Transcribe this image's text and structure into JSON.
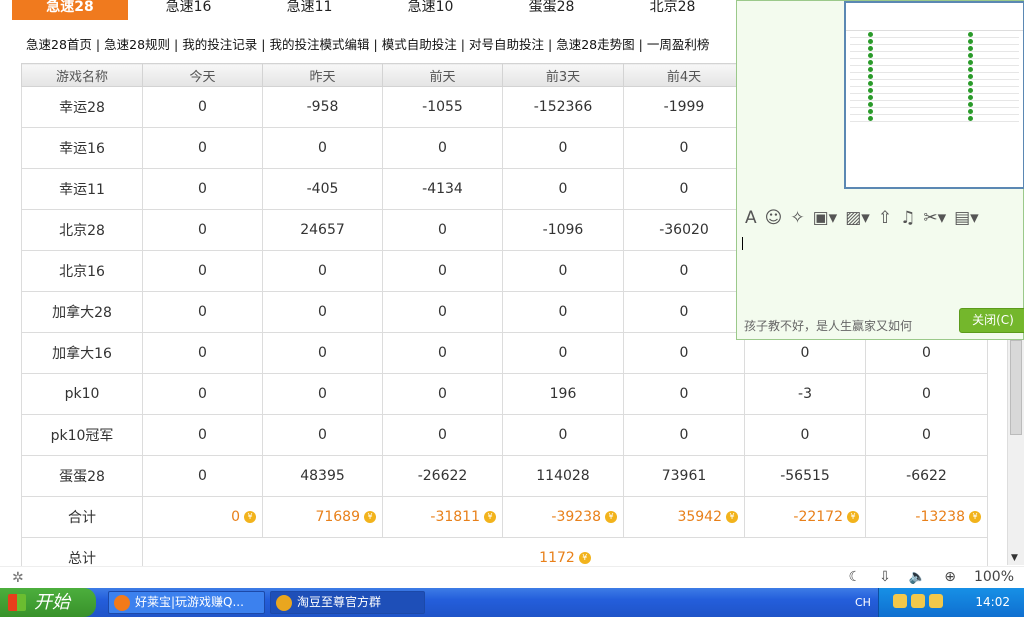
{
  "tabs": [
    "急速28",
    "急速16",
    "急速11",
    "急速10",
    "蛋蛋28",
    "北京28"
  ],
  "subnav": [
    "急速28首页",
    "急速28规则",
    "我的投注记录",
    "我的投注模式编辑",
    "模式自助投注",
    "对号自助投注",
    "急速28走势图",
    "一周盈利榜"
  ],
  "subnav_sep": "|",
  "table": {
    "headers": [
      "游戏名称",
      "今天",
      "昨天",
      "前天",
      "前3天",
      "前4天",
      "",
      ""
    ],
    "rows": [
      [
        "幸运28",
        "0",
        "-958",
        "-1055",
        "-152366",
        "-1999",
        "",
        ""
      ],
      [
        "幸运16",
        "0",
        "0",
        "0",
        "0",
        "0",
        "",
        ""
      ],
      [
        "幸运11",
        "0",
        "-405",
        "-4134",
        "0",
        "0",
        "",
        ""
      ],
      [
        "北京28",
        "0",
        "24657",
        "0",
        "-1096",
        "-36020",
        "",
        ""
      ],
      [
        "北京16",
        "0",
        "0",
        "0",
        "0",
        "0",
        "",
        ""
      ],
      [
        "加拿大28",
        "0",
        "0",
        "0",
        "0",
        "0",
        "",
        ""
      ],
      [
        "加拿大16",
        "0",
        "0",
        "0",
        "0",
        "0",
        "0",
        "0"
      ],
      [
        "pk10",
        "0",
        "0",
        "0",
        "196",
        "0",
        "-3",
        "0"
      ],
      [
        "pk10冠军",
        "0",
        "0",
        "0",
        "0",
        "0",
        "0",
        "0"
      ],
      [
        "蛋蛋28",
        "0",
        "48395",
        "-26622",
        "114028",
        "73961",
        "-56515",
        "-6622"
      ]
    ],
    "sum_label": "合计",
    "sums": [
      "0",
      "71689",
      "-31811",
      "-39238",
      "35942",
      "-22172",
      "-13238"
    ],
    "total_label": "总计",
    "total": "1172",
    "coin_glyph": "¥"
  },
  "chat": {
    "hint": "孩子教不好，是人生赢家又如何",
    "close_label": "关闭(C)"
  },
  "status_zoom": "100%",
  "taskbar": {
    "start_label": "开始",
    "tasks": [
      "好莱宝|玩游戏赚Q...",
      "淘豆至尊官方群"
    ],
    "lang": "CH",
    "clock": "14:02"
  },
  "colors": {
    "accent": "#f07a1e",
    "sum_text": "#e8801a",
    "close_button": "#74b72c",
    "taskbar": "#245edb"
  }
}
